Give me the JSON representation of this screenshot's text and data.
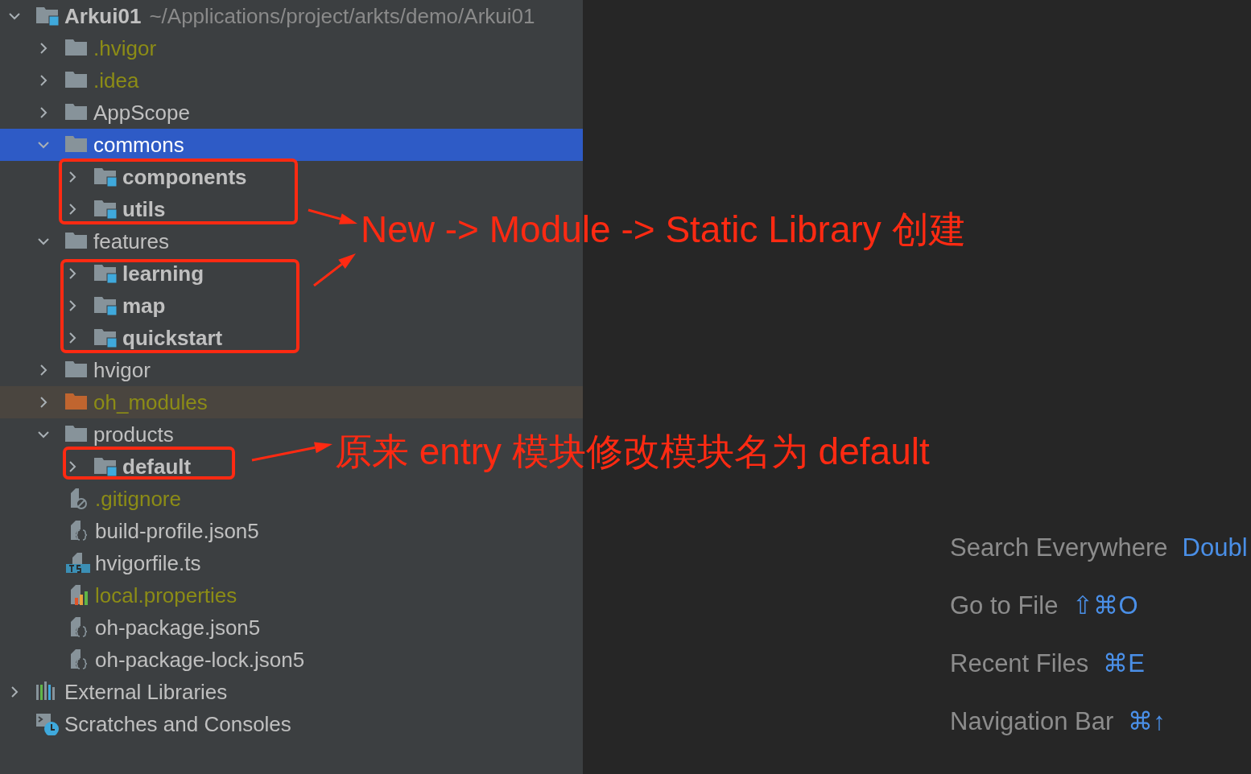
{
  "project_tree": {
    "items": [
      {
        "label": "Arkui01",
        "path": "~/Applications/project/arkts/demo/Arkui01",
        "kind": "module",
        "ignored": false,
        "expanded": true,
        "selected": false,
        "children": [
          {
            "label": ".hvigor",
            "kind": "folder",
            "ignored": true,
            "expanded": false,
            "selected": false
          },
          {
            "label": ".idea",
            "kind": "folder",
            "ignored": true,
            "expanded": false,
            "selected": false
          },
          {
            "label": "AppScope",
            "kind": "folder",
            "ignored": false,
            "expanded": false,
            "selected": false
          },
          {
            "label": "commons",
            "kind": "folder",
            "ignored": false,
            "expanded": true,
            "selected": true,
            "children": [
              {
                "label": "components",
                "kind": "module",
                "ignored": false,
                "expanded": false,
                "selected": false
              },
              {
                "label": "utils",
                "kind": "module",
                "ignored": false,
                "expanded": false,
                "selected": false
              }
            ]
          },
          {
            "label": "features",
            "kind": "folder",
            "ignored": false,
            "expanded": true,
            "selected": false,
            "children": [
              {
                "label": "learning",
                "kind": "module",
                "ignored": false,
                "expanded": false,
                "selected": false
              },
              {
                "label": "map",
                "kind": "module",
                "ignored": false,
                "expanded": false,
                "selected": false
              },
              {
                "label": "quickstart",
                "kind": "module",
                "ignored": false,
                "expanded": false,
                "selected": false
              }
            ]
          },
          {
            "label": "hvigor",
            "kind": "folder",
            "ignored": false,
            "expanded": false,
            "selected": false
          },
          {
            "label": "oh_modules",
            "kind": "excluded",
            "ignored": true,
            "expanded": false,
            "selected": false
          },
          {
            "label": "products",
            "kind": "folder",
            "ignored": false,
            "expanded": true,
            "selected": false,
            "children": [
              {
                "label": "default",
                "kind": "module",
                "ignored": false,
                "expanded": false,
                "selected": false
              }
            ]
          },
          {
            "label": ".gitignore",
            "kind": "gitignore",
            "ignored": true,
            "selected": false
          },
          {
            "label": "build-profile.json5",
            "kind": "json",
            "ignored": false,
            "selected": false
          },
          {
            "label": "hvigorfile.ts",
            "kind": "ts",
            "ignored": false,
            "selected": false
          },
          {
            "label": "local.properties",
            "kind": "properties",
            "ignored": true,
            "selected": false
          },
          {
            "label": "oh-package.json5",
            "kind": "json",
            "ignored": false,
            "selected": false
          },
          {
            "label": "oh-package-lock.json5",
            "kind": "json",
            "ignored": false,
            "selected": false
          }
        ]
      },
      {
        "label": "External Libraries",
        "kind": "libraries",
        "ignored": false,
        "expanded": false,
        "selected": false
      },
      {
        "label": "Scratches and Consoles",
        "kind": "scratches",
        "ignored": false,
        "selected": false
      }
    ]
  },
  "annotations": [
    {
      "text": "New -> Module -> Static Library 创建"
    },
    {
      "text": "原来 entry 模块修改模块名为 default"
    }
  ],
  "editor_hints": [
    {
      "label": "Search Everywhere",
      "shortcut": "Doubl"
    },
    {
      "label": "Go to File",
      "shortcut": "⇧⌘O"
    },
    {
      "label": "Recent Files",
      "shortcut": "⌘E"
    },
    {
      "label": "Navigation Bar",
      "shortcut": "⌘↑"
    }
  ]
}
